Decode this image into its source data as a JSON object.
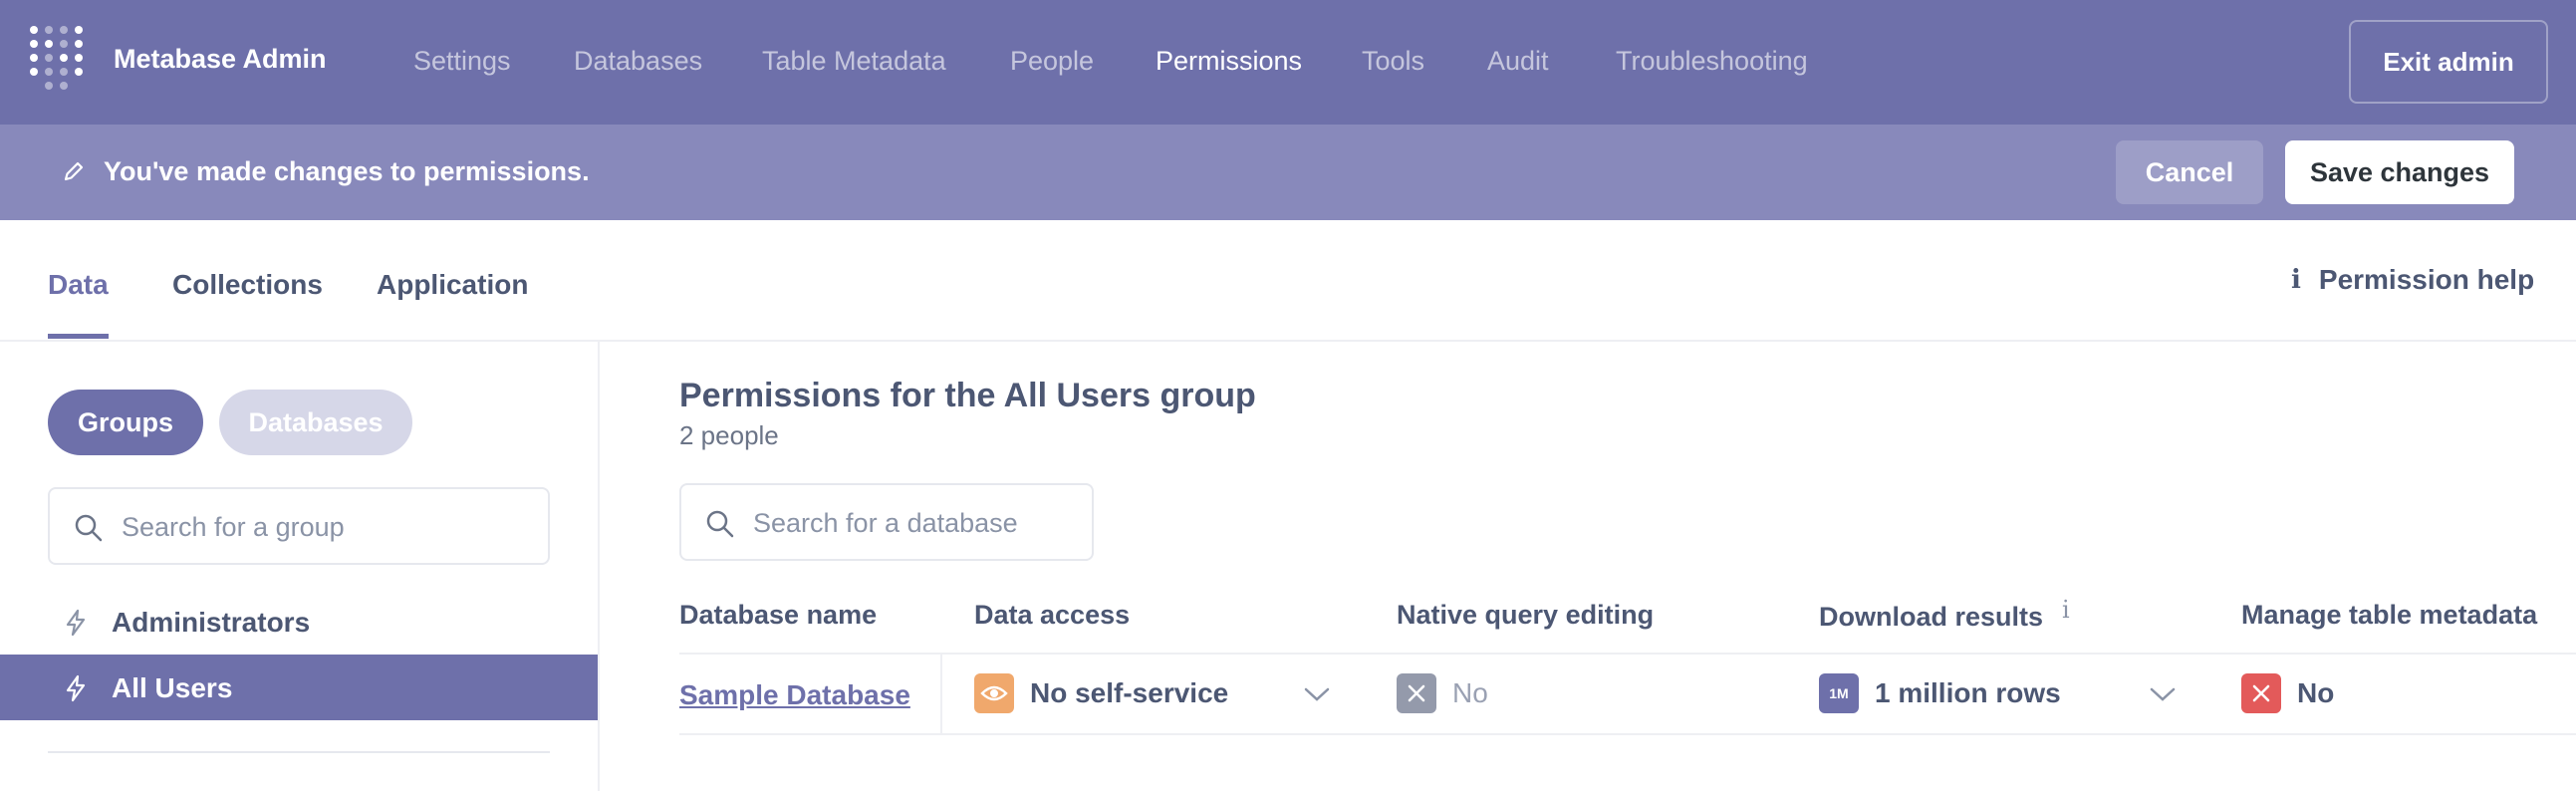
{
  "nav": {
    "brand": "Metabase Admin",
    "links": [
      "Settings",
      "Databases",
      "Table Metadata",
      "People",
      "Permissions",
      "Tools",
      "Audit",
      "Troubleshooting"
    ],
    "active": "Permissions",
    "exit_label": "Exit admin"
  },
  "changes_bar": {
    "message": "You've made changes to permissions.",
    "cancel_label": "Cancel",
    "save_label": "Save changes"
  },
  "tabs": {
    "items": [
      "Data",
      "Collections",
      "Application"
    ],
    "active": "Data",
    "help_label": "Permission help"
  },
  "sidebar": {
    "toggle": {
      "groups": "Groups",
      "databases": "Databases",
      "active": "Groups"
    },
    "search_placeholder": "Search for a group",
    "groups": [
      "Administrators",
      "All Users"
    ],
    "selected": "All Users"
  },
  "main": {
    "title": "Permissions for the All Users group",
    "subtitle": "2 people",
    "search_placeholder": "Search for a database",
    "columns": [
      "Database name",
      "Data access",
      "Native query editing",
      "Download results",
      "Manage table metadata"
    ],
    "rows": [
      {
        "database": "Sample Database",
        "data_access": "No self-service",
        "native_query": "No",
        "download": "1 million rows",
        "download_badge": "1M",
        "manage_metadata": "No"
      }
    ]
  },
  "colors": {
    "brand": "#6e70aa",
    "changes_bar": "#8889bb",
    "data_access_badge": "#f0a86c",
    "native_badge": "#949aab",
    "download_badge": "#6e70aa",
    "metadata_badge": "#e35a5a"
  }
}
